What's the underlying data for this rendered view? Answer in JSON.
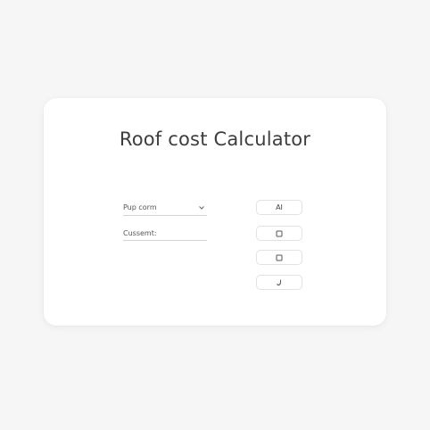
{
  "calculator": {
    "title": "Roof cost Calculator",
    "dropdown": {
      "selected": "Pup corm",
      "icon": "chevron-down-icon"
    },
    "input": {
      "label": "Cussemt:"
    },
    "buttons": [
      {
        "label": "AI"
      },
      {
        "icon": "square-icon"
      },
      {
        "icon": "square-icon"
      },
      {
        "icon": "curl-icon"
      }
    ]
  }
}
